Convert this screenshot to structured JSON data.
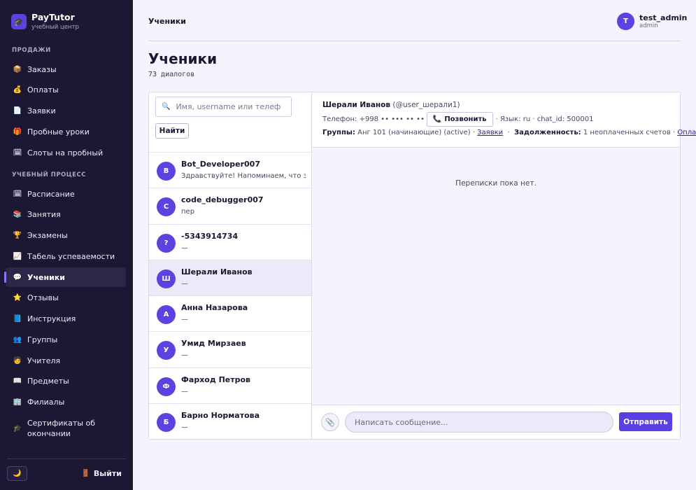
{
  "brand": {
    "name": "PayTutor",
    "subtitle": "учебный центр",
    "logo_icon": "graduation-icon"
  },
  "sidebar": {
    "sections": [
      {
        "title": "ПРОДАЖИ"
      },
      {
        "title": "УЧЕБНЫЙ ПРОЦЕСС"
      }
    ],
    "items": [
      {
        "label": "Заказы",
        "icon": "📦"
      },
      {
        "label": "Оплаты",
        "icon": "💰"
      },
      {
        "label": "Заявки",
        "icon": "📄"
      },
      {
        "label": "Пробные уроки",
        "icon": "🎁"
      },
      {
        "label": "Слоты на пробный",
        "icon": "🗓"
      },
      {
        "label": "Расписание",
        "icon": "🗓"
      },
      {
        "label": "Занятия",
        "icon": "📚"
      },
      {
        "label": "Экзамены",
        "icon": "🏆"
      },
      {
        "label": "Табель успеваемости",
        "icon": "📈"
      },
      {
        "label": "Ученики",
        "icon": "💬"
      },
      {
        "label": "Отзывы",
        "icon": "⭐"
      },
      {
        "label": "Инструкция",
        "icon": "📘"
      },
      {
        "label": "Группы",
        "icon": "👥"
      },
      {
        "label": "Учителя",
        "icon": "🧑"
      },
      {
        "label": "Предметы",
        "icon": "📖"
      },
      {
        "label": "Филиалы",
        "icon": "🏢"
      },
      {
        "label": "Сертификаты об окончании",
        "icon": "🎓"
      }
    ],
    "theme_icon": "🌙",
    "logout_icon": "🚪",
    "logout_label": "Выйти"
  },
  "topbar": {
    "title": "Ученики"
  },
  "user": {
    "initial": "T",
    "name": "test_admin",
    "role": "admin"
  },
  "page": {
    "title": "Ученики",
    "count": "73 диалогов"
  },
  "search": {
    "placeholder": "Имя, username или телефон",
    "value": "",
    "icon": "🔍",
    "button": "Найти"
  },
  "dialogs": [
    {
      "initial": "B",
      "name": "Bot_Developer007",
      "preview": "Здравствуйте! Напоминаем, что занятие"
    },
    {
      "initial": "C",
      "name": "code_debugger007",
      "preview": "пер"
    },
    {
      "initial": "?",
      "name": "-5343914734",
      "preview": "—"
    },
    {
      "initial": "Ш",
      "name": "Шерали Иванов",
      "preview": "—"
    },
    {
      "initial": "А",
      "name": "Анна Назарова",
      "preview": "—"
    },
    {
      "initial": "У",
      "name": "Умид Мирзаев",
      "preview": "—"
    },
    {
      "initial": "Ф",
      "name": "Фарход Петров",
      "preview": "—"
    },
    {
      "initial": "Б",
      "name": "Барно Норматова",
      "preview": "—"
    }
  ],
  "chat": {
    "name": "Шерали Иванов",
    "username": "(@user_шерали1)",
    "phone_label": "Телефон:",
    "phone_value": "+998 •• ••• •• ••",
    "call_icon": "📞",
    "call_button": "Позвонить",
    "lang_info": "· Язык: ru · chat_id: 500001",
    "groups_label": "Группы:",
    "groups_value": "Анг 101 (начинающие) (active) ·",
    "requests_link": "Заявки",
    "sep": "·",
    "debt_label": "Задолженность:",
    "debt_value": "1 неоплаченных счетов ·",
    "payments_link": "Оплаты",
    "empty_text": "Переписки пока нет.",
    "attach_icon": "📎",
    "message_placeholder": "Написать сообщение...",
    "send_button": "Отправить"
  }
}
